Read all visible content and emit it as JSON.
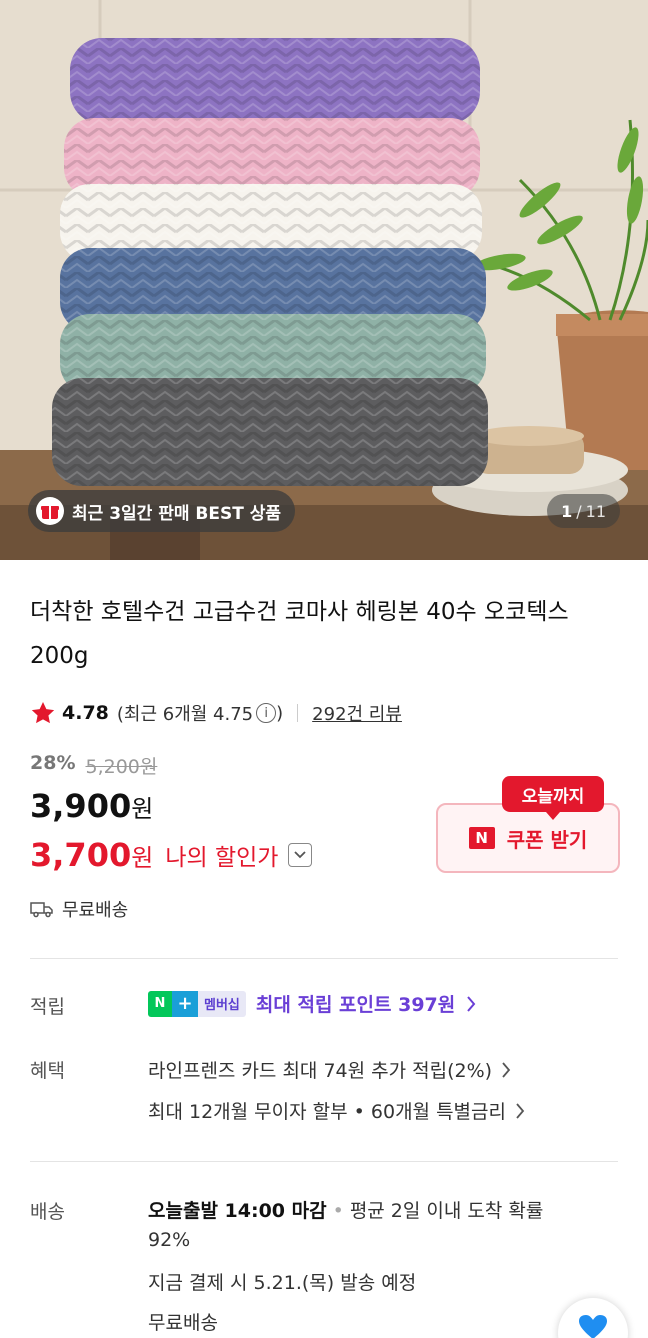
{
  "gallery": {
    "badge_text": "최근 3일간 판매 BEST 상품",
    "current": "1",
    "separator": "/",
    "total": "11"
  },
  "product": {
    "title": "더착한 호텔수건 고급수건 코마사 헤링본 40수 오코텍스 200g",
    "rating": "4.78",
    "recent_rating_text": "(최근 6개월 4.75",
    "recent_rating_close": ")",
    "info_symbol": "i",
    "review_link": "292건 리뷰",
    "discount_pct": "28%",
    "original_price": "5,200원",
    "price": "3,900",
    "price_unit": "원",
    "my_price": "3,700",
    "my_price_unit": "원",
    "my_price_label": "나의 할인가",
    "coupon_tag": "오늘까지",
    "coupon_logo": "N",
    "coupon_button": "쿠폰 받기",
    "shipping": "무료배송"
  },
  "points": {
    "label": "적립",
    "badge_n": "N",
    "badge_plus": "+",
    "badge_membership": "멤버십",
    "text": "최대 적립 포인트 397원"
  },
  "benefits": {
    "label": "혜택",
    "items": [
      "라인프렌즈 카드 최대 74원 추가 적립(2%)",
      "최대 12개월 무이자 할부 • 60개월 특별금리"
    ]
  },
  "delivery": {
    "label": "배송",
    "dispatch": "오늘출발 14:00 마감",
    "separator": "•",
    "arrival_prob_line1": "평균 2일 이내 도착 확률",
    "arrival_prob_line2": "92%",
    "schedule": "지금 결제 시 5.21.(목) 발송 예정",
    "fee": "무료배송"
  },
  "colors": {
    "accent_red": "#e3182d",
    "points_purple": "#6a3fd6",
    "naver_green": "#03c75a"
  }
}
